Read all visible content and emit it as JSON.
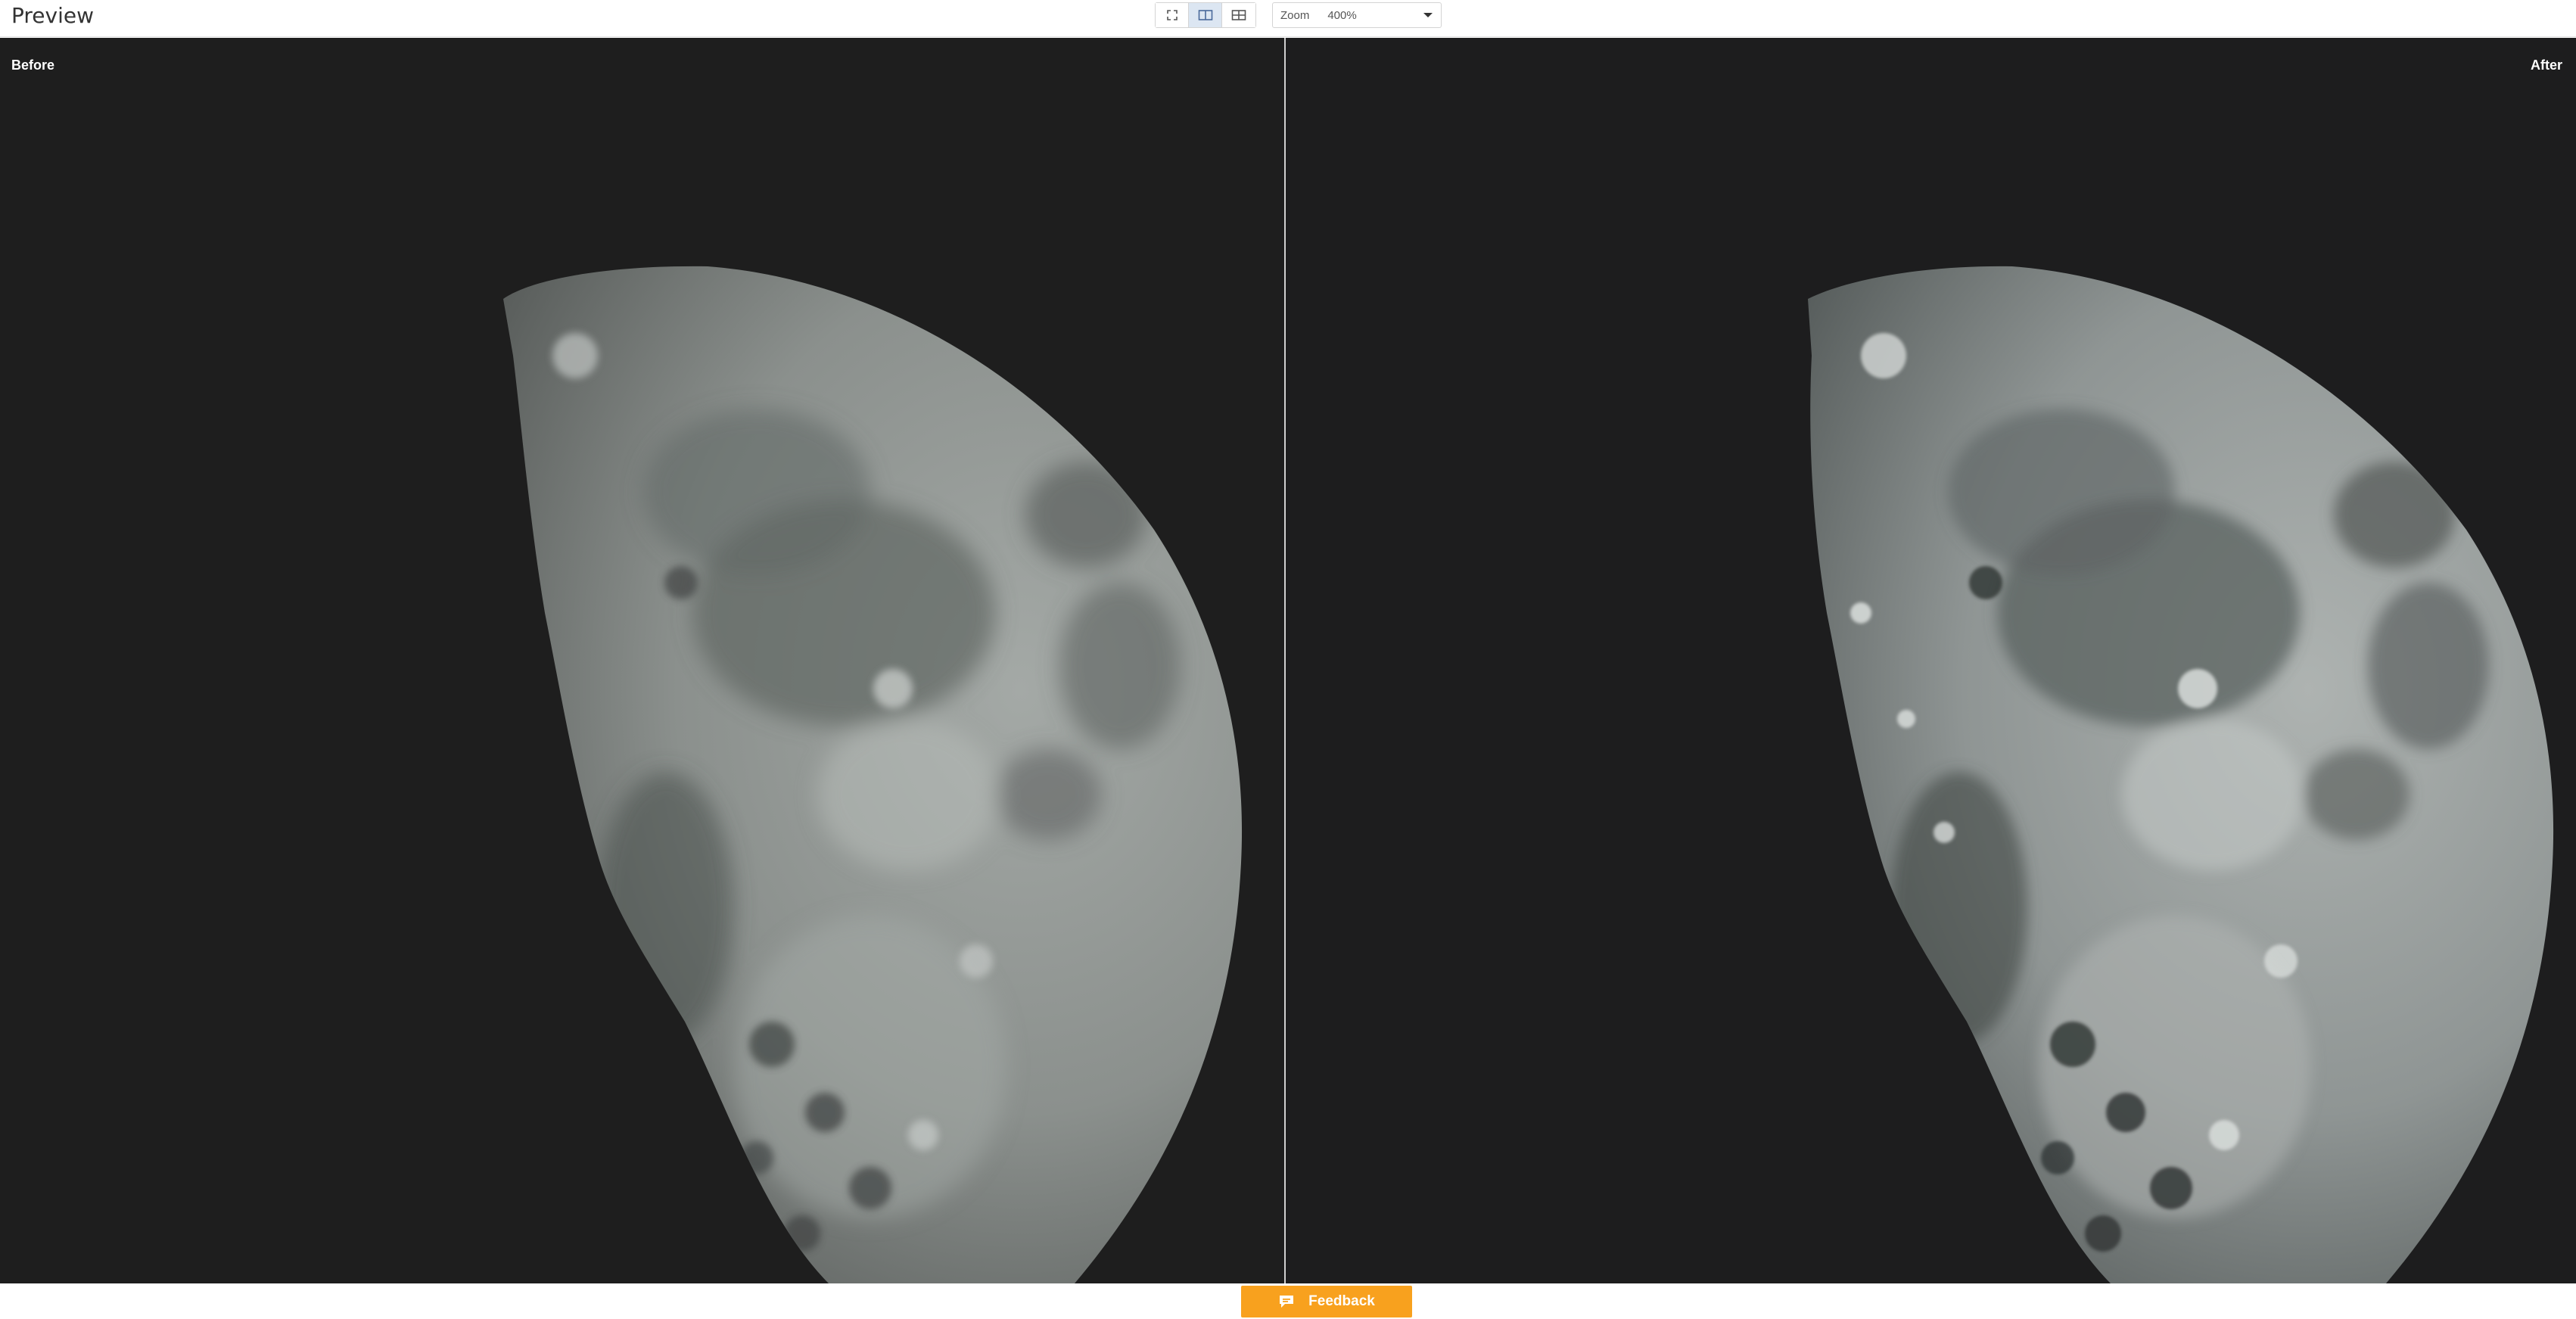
{
  "header": {
    "title": "Preview",
    "view_modes": [
      {
        "name": "fullscreen-view",
        "icon": "expand-icon",
        "active": false
      },
      {
        "name": "split-view",
        "icon": "split-columns-icon",
        "active": true
      },
      {
        "name": "side-by-side-view",
        "icon": "grid-compare-icon",
        "active": false
      }
    ],
    "zoom": {
      "label": "Zoom",
      "value": "400%",
      "icon": "chevron-down-icon"
    }
  },
  "preview": {
    "before_label": "Before",
    "after_label": "After",
    "image_subject": "moon",
    "background_color": "#1e1e1e"
  },
  "footer": {
    "feedback_label": "Feedback",
    "feedback_icon": "chat-bubble-icon",
    "accent_color": "#f8a11e"
  }
}
